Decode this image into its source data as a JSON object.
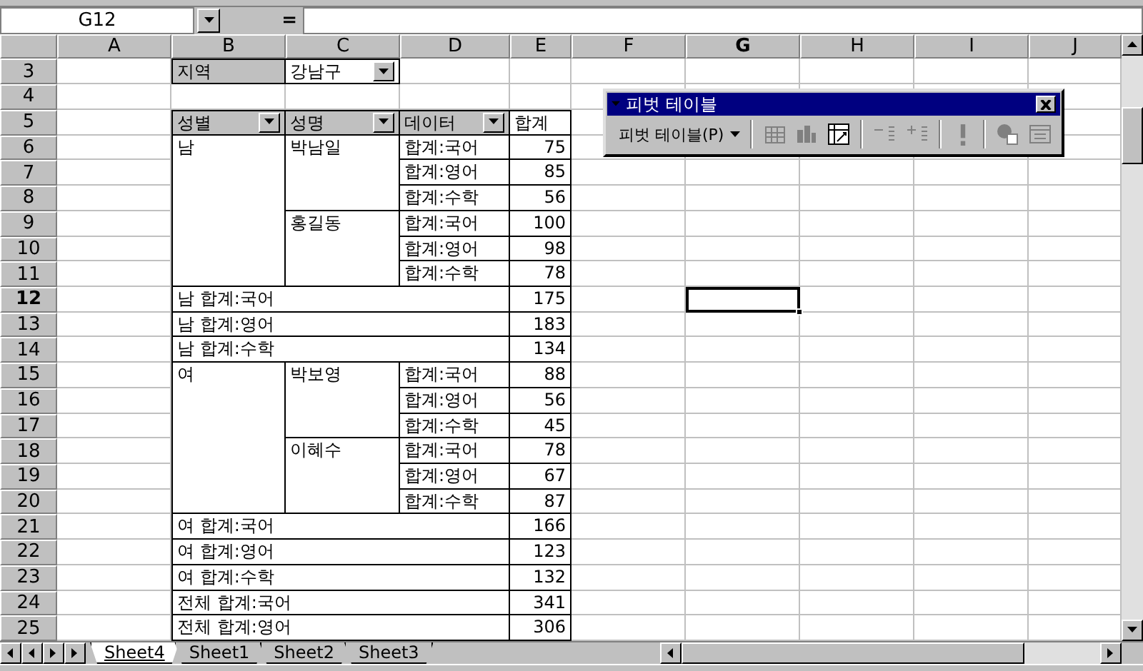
{
  "name_box": "G12",
  "formula_label": "=",
  "columns": [
    {
      "label": "A",
      "selected": false
    },
    {
      "label": "B",
      "selected": false
    },
    {
      "label": "C",
      "selected": false
    },
    {
      "label": "D",
      "selected": false
    },
    {
      "label": "E",
      "selected": false
    },
    {
      "label": "F",
      "selected": false
    },
    {
      "label": "G",
      "selected": true
    },
    {
      "label": "H",
      "selected": false
    },
    {
      "label": "I",
      "selected": false
    },
    {
      "label": "J",
      "selected": false
    }
  ],
  "rows": [
    {
      "label": "3",
      "selected": false
    },
    {
      "label": "4",
      "selected": false
    },
    {
      "label": "5",
      "selected": false
    },
    {
      "label": "6",
      "selected": false
    },
    {
      "label": "7",
      "selected": false
    },
    {
      "label": "8",
      "selected": false
    },
    {
      "label": "9",
      "selected": false
    },
    {
      "label": "10",
      "selected": false
    },
    {
      "label": "11",
      "selected": false
    },
    {
      "label": "12",
      "selected": true
    },
    {
      "label": "13",
      "selected": false
    },
    {
      "label": "14",
      "selected": false
    },
    {
      "label": "15",
      "selected": false
    },
    {
      "label": "16",
      "selected": false
    },
    {
      "label": "17",
      "selected": false
    },
    {
      "label": "18",
      "selected": false
    },
    {
      "label": "19",
      "selected": false
    },
    {
      "label": "20",
      "selected": false
    },
    {
      "label": "21",
      "selected": false
    },
    {
      "label": "22",
      "selected": false
    },
    {
      "label": "23",
      "selected": false
    },
    {
      "label": "24",
      "selected": false
    },
    {
      "label": "25",
      "selected": false
    }
  ],
  "pivot": {
    "page_field": {
      "label": "지역",
      "value": "강남구"
    },
    "header": [
      {
        "label": "성별",
        "kind": "field"
      },
      {
        "label": "성명",
        "kind": "field"
      },
      {
        "label": "데이터",
        "kind": "field"
      },
      {
        "label": "합계",
        "kind": "plain"
      }
    ],
    "groups": [
      {
        "label": "남",
        "people": [
          {
            "name": "박남일",
            "items": [
              {
                "label": "합계:국어",
                "value": "75"
              },
              {
                "label": "합계:영어",
                "value": "85"
              },
              {
                "label": "합계:수학",
                "value": "56"
              }
            ]
          },
          {
            "name": "홍길동",
            "items": [
              {
                "label": "합계:국어",
                "value": "100"
              },
              {
                "label": "합계:영어",
                "value": "98"
              },
              {
                "label": "합계:수학",
                "value": "78"
              }
            ]
          }
        ],
        "subtotals": [
          {
            "label": "남 합계:국어",
            "value": "175"
          },
          {
            "label": "남 합계:영어",
            "value": "183"
          },
          {
            "label": "남 합계:수학",
            "value": "134"
          }
        ]
      },
      {
        "label": "여",
        "people": [
          {
            "name": "박보영",
            "items": [
              {
                "label": "합계:국어",
                "value": "88"
              },
              {
                "label": "합계:영어",
                "value": "56"
              },
              {
                "label": "합계:수학",
                "value": "45"
              }
            ]
          },
          {
            "name": "이혜수",
            "items": [
              {
                "label": "합계:국어",
                "value": "78"
              },
              {
                "label": "합계:영어",
                "value": "67"
              },
              {
                "label": "합계:수학",
                "value": "87"
              }
            ]
          }
        ],
        "subtotals": [
          {
            "label": "여 합계:국어",
            "value": "166"
          },
          {
            "label": "여 합계:영어",
            "value": "123"
          },
          {
            "label": "여 합계:수학",
            "value": "132"
          }
        ]
      }
    ],
    "grand_totals": [
      {
        "label": "전체 합계:국어",
        "value": "341"
      },
      {
        "label": "전체 합계:영어",
        "value": "306"
      }
    ]
  },
  "pivot_toolbar": {
    "title": "피벗 테이블",
    "menu": "피벗 테이블(P)",
    "buttons": [
      {
        "kind": "format",
        "disabled": true
      },
      {
        "kind": "chart",
        "disabled": true
      },
      {
        "kind": "wizard",
        "disabled": false
      },
      {
        "kind": "hide",
        "disabled": true
      },
      {
        "kind": "show",
        "disabled": true
      },
      {
        "kind": "refresh",
        "disabled": true
      },
      {
        "kind": "field",
        "disabled": true
      },
      {
        "kind": "fieldlist",
        "disabled": true
      }
    ]
  },
  "sheet_tabs": [
    {
      "label": "Sheet4",
      "selected": true
    },
    {
      "label": "Sheet1",
      "selected": false
    },
    {
      "label": "Sheet2",
      "selected": false
    },
    {
      "label": "Sheet3",
      "selected": false
    }
  ]
}
